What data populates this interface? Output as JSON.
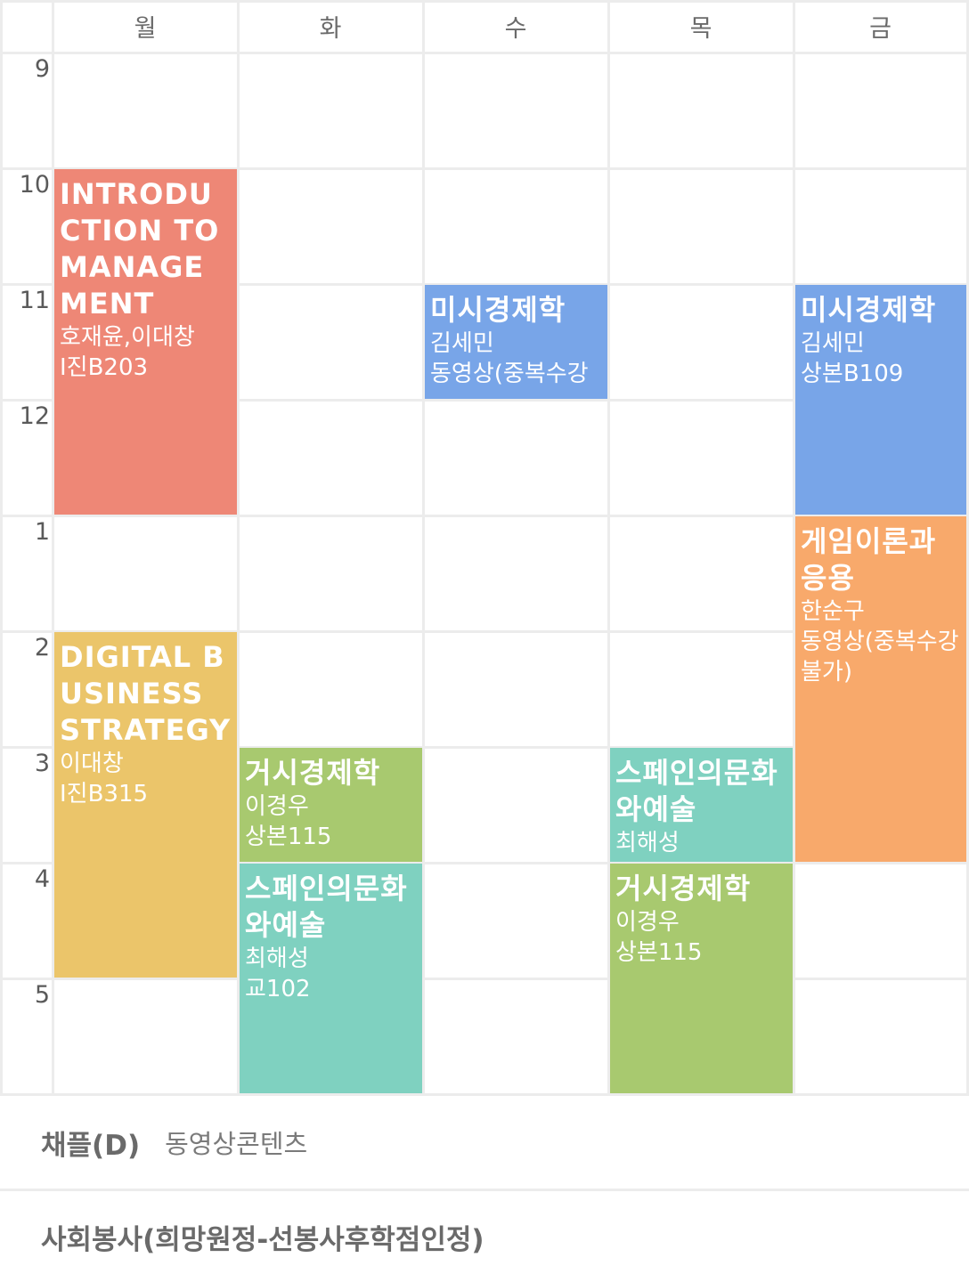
{
  "days": [
    "월",
    "화",
    "수",
    "목",
    "금"
  ],
  "hours": [
    "9",
    "10",
    "11",
    "12",
    "1",
    "2",
    "3",
    "4",
    "5"
  ],
  "colors": {
    "grid_line": "#ececec",
    "red": "#ee8776",
    "yellow": "#ebc56a",
    "blue": "#78a5e8",
    "orange": "#f8a96b",
    "green": "#a8c96f",
    "teal": "#7fd1c0"
  },
  "courses": [
    {
      "name": "INTRODUCTION TO MANAGEMENT",
      "sub1": "호재윤,이대창",
      "sub2": "I진B203"
    },
    {
      "name": "DIGITAL BUSINESS STRATEGY",
      "sub1": "이대창",
      "sub2": "I진B315"
    },
    {
      "name": "거시경제학",
      "sub1": "이경우",
      "sub2": "상본115"
    },
    {
      "name": "스페인의문화와예술",
      "sub1": "최해성",
      "sub2": "교102"
    },
    {
      "name": "미시경제학",
      "sub1": "김세민",
      "sub2": "동영상(중복수강"
    },
    {
      "name": "스페인의문화와예술",
      "sub1": "최해성",
      "sub2": ""
    },
    {
      "name": "거시경제학",
      "sub1": "이경우",
      "sub2": "상본115"
    },
    {
      "name": "미시경제학",
      "sub1": "김세민",
      "sub2": "상본B109"
    },
    {
      "name": "게임이론과응용",
      "sub1": "한순구",
      "sub2": "동영상(중복수강불가)"
    }
  ],
  "extras": [
    {
      "name": "채플(D)",
      "sub": "동영상콘텐츠"
    },
    {
      "name": "사회봉사(희망원정-선봉사후학점인정)",
      "sub": ""
    }
  ]
}
